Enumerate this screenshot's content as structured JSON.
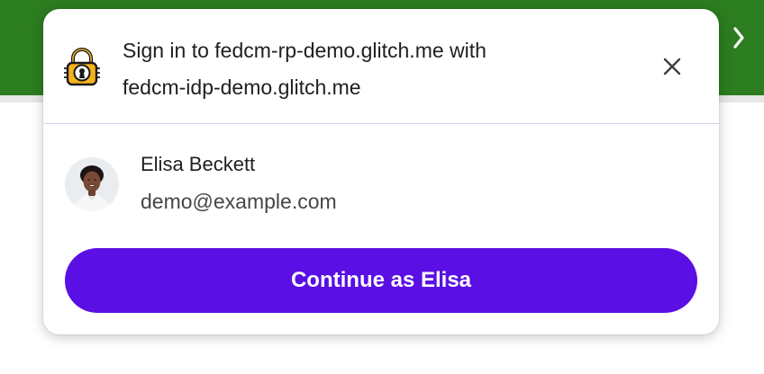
{
  "background": {
    "header_color": "#2c7d1f",
    "nav_icon": "chevron-right-icon"
  },
  "dialog": {
    "idp_icon": "lock-keyhole-icon",
    "title_line1": "Sign in to fedcm-rp-demo.glitch.me with",
    "title_line2": "fedcm-idp-demo.glitch.me",
    "close_icon": "close-icon",
    "account": {
      "avatar_icon": "avatar",
      "name": "Elisa Beckett",
      "email": "demo@example.com"
    },
    "continue_label": "Continue as Elisa",
    "accent_color": "#5a0fe4"
  }
}
